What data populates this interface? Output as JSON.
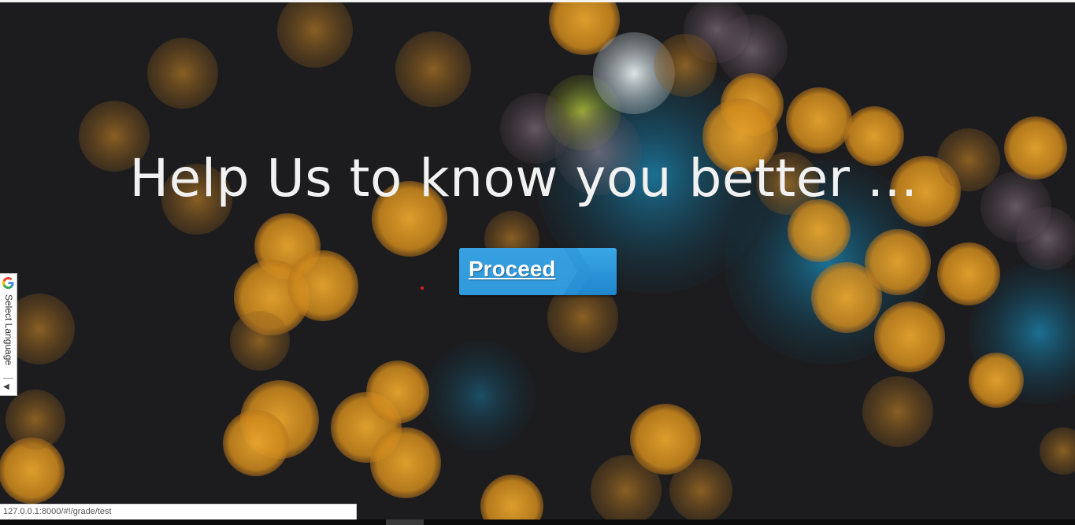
{
  "hero": {
    "headline": "Help Us to know you better ...",
    "proceed_label": "Proceed"
  },
  "translate_widget": {
    "label": "Select Language",
    "arrow": "◀",
    "icon": "google-g-icon"
  },
  "status_bar": {
    "url": "127.0.0.1:8000/#!/grade/test"
  },
  "colors": {
    "background": "#1c1c1e",
    "bokeh_amber": "#e0a12a",
    "bokeh_teal": "#1f6a8c",
    "button_blue": "#2a95d8",
    "headline_text": "#f1f1f1"
  }
}
